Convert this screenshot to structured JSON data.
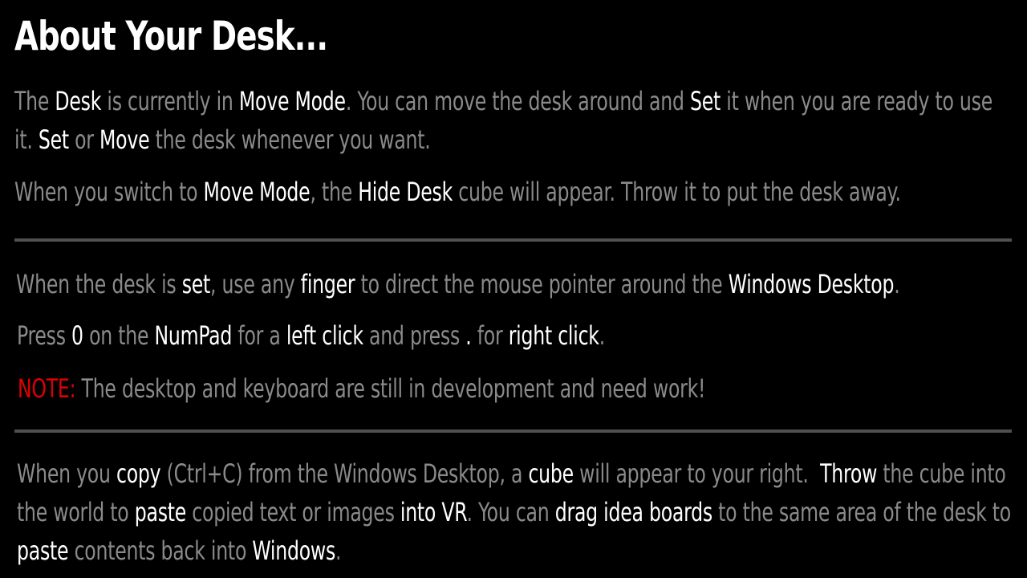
{
  "title": "About Your Desk...",
  "colors": {
    "background": "#000000",
    "body_text": "#8a8a8a",
    "highlight_text": "#ffffff",
    "note_label": "#e00000",
    "divider": "#505050"
  },
  "section_move": {
    "p1": {
      "s1": "The ",
      "s2": "Desk",
      "s3": " is currently in ",
      "s4": "Move Mode",
      "s5": ". You can move the desk around and ",
      "s6": "Set",
      "s7": " it when you are ready to use it. ",
      "s8": "Set",
      "s9": " or ",
      "s10": "Move",
      "s11": " the desk whenever you want."
    },
    "p2": {
      "s1": "When you switch to ",
      "s2": "Move Mode",
      "s3": ", the ",
      "s4": "Hide Desk",
      "s5": " cube will appear. Throw it to put the desk away."
    }
  },
  "section_mouse": {
    "p3": {
      "s1": "When the desk is ",
      "s2": "set",
      "s3": ", use any ",
      "s4": "finger",
      "s5": " to direct the mouse pointer around the ",
      "s6": "Windows Desktop",
      "s7": "."
    },
    "p4": {
      "s1": "Press ",
      "s2": "0",
      "s3": " on the ",
      "s4": "NumPad",
      "s5": " for a ",
      "s6": "left click",
      "s7": " and press ",
      "s8": ".",
      "s9": " for ",
      "s10": "right click",
      "s11": "."
    },
    "p5": {
      "note_label": "NOTE:",
      "s1": " The desktop and keyboard are still in development and need work!"
    }
  },
  "section_clipboard": {
    "p6": {
      "s1": "When you ",
      "s2": "copy",
      "s3": " (Ctrl+C) from the Windows Desktop, a ",
      "s4": "cube",
      "s5": " will appear to your right.  ",
      "s6": "Throw",
      "s7": " the cube into the world to ",
      "s8": "paste",
      "s9": " copied text or images ",
      "s10": "into VR",
      "s11": ". You can ",
      "s12": "drag idea boards",
      "s13": " to the same area of the desk to ",
      "s14": "paste",
      "s15": " contents back into ",
      "s16": "Windows",
      "s17": "."
    }
  }
}
